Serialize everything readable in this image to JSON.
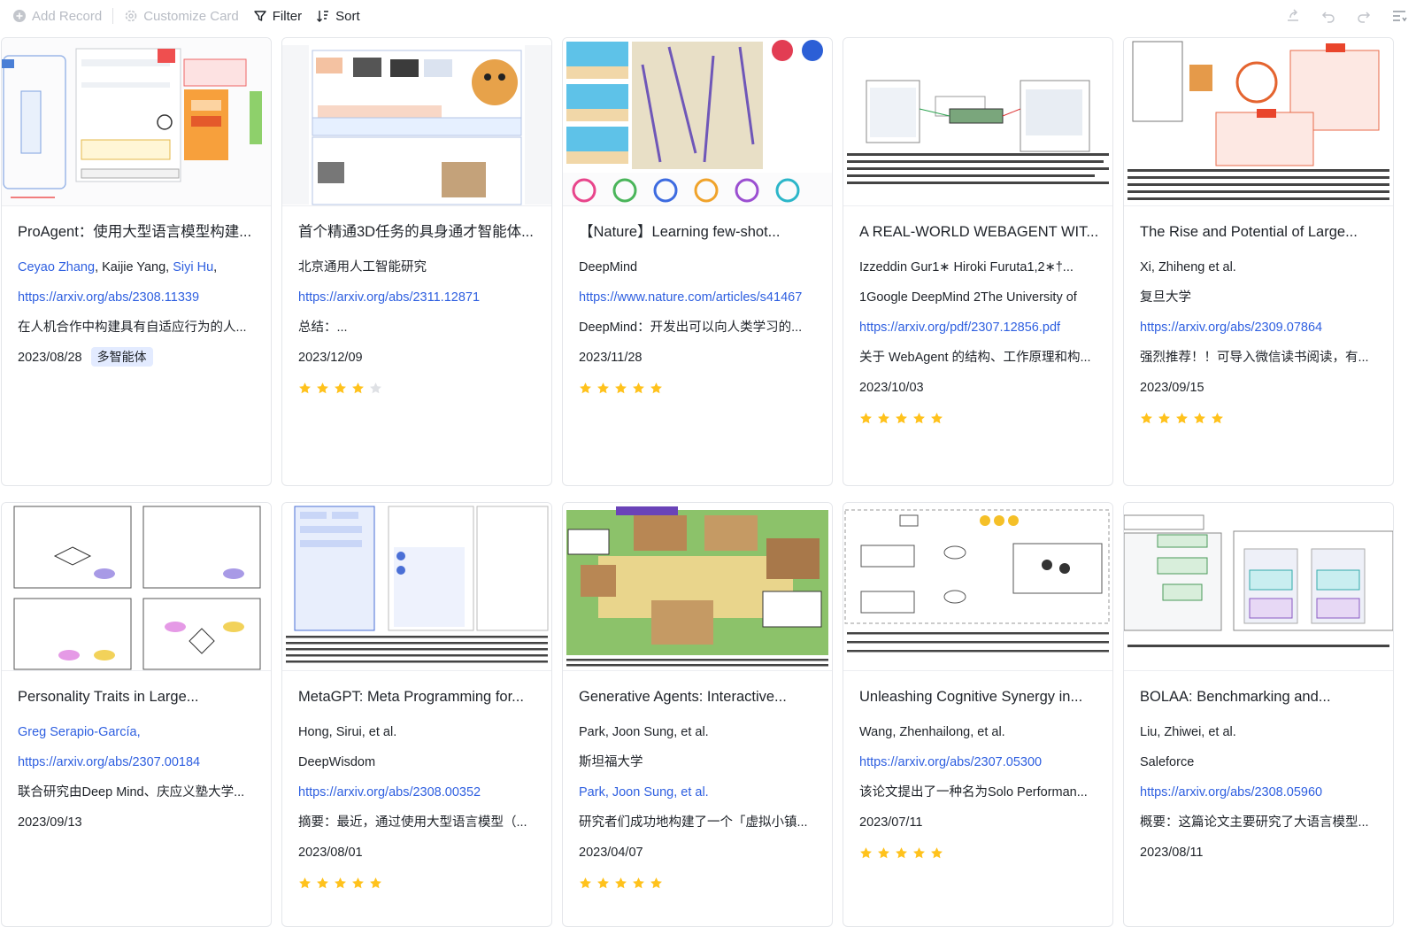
{
  "toolbar": {
    "add_record": "Add Record",
    "customize_card": "Customize Card",
    "filter": "Filter",
    "sort": "Sort"
  },
  "colors": {
    "link": "#2e5fe0",
    "star_on": "#ffc21c",
    "star_off": "#dfe1e5",
    "tag_bg": "#e3ebff"
  },
  "cards": [
    {
      "title": "ProAgent：使用大型语言模型构建...",
      "authors_linked": [
        "Ceyao Zhang",
        ", Kaijie Yang, ",
        "Siyi Hu",
        ","
      ],
      "url": "https://arxiv.org/abs/2308.11339",
      "summary": "在人机合作中构建具有自适应行为的人...",
      "date": "2023/08/28",
      "tag": "多智能体"
    },
    {
      "title": "首个精通3D任务的具身通才智能体...",
      "org": "北京通用人工智能研究",
      "url": "https://arxiv.org/abs/2311.12871",
      "summary": "总结：...",
      "date": "2023/12/09",
      "rating": 4
    },
    {
      "title": "【Nature】Learning few-shot...",
      "org": "DeepMind",
      "url": "https://www.nature.com/articles/s41467",
      "summary": "DeepMind：开发出可以向人类学习的...",
      "date": "2023/11/28",
      "rating": 5
    },
    {
      "title": "A REAL-WORLD WEBAGENT WIT...",
      "authors": "Izzeddin Gur1∗ Hiroki Furuta1,2∗†...",
      "org": "1Google DeepMind 2The University of",
      "url": "https://arxiv.org/pdf/2307.12856.pdf",
      "summary": "关于 WebAgent 的结构、工作原理和构...",
      "date": "2023/10/03",
      "rating": 5
    },
    {
      "title": "The Rise and Potential of Large...",
      "authors": "Xi, Zhiheng et al.",
      "org": "复旦大学",
      "url": "https://arxiv.org/abs/2309.07864",
      "summary": "强烈推荐！！可导入微信读书阅读，有...",
      "date": "2023/09/15",
      "rating": 5
    },
    {
      "title": "Personality Traits in Large...",
      "authors_link": "Greg Serapio-García,",
      "url": "https://arxiv.org/abs/2307.00184",
      "summary": "联合研究由Deep Mind、庆应义塾大学...",
      "date": "2023/09/13"
    },
    {
      "title": "MetaGPT: Meta Programming for...",
      "authors": "Hong, Sirui, et al.",
      "org": "DeepWisdom",
      "url": "https://arxiv.org/abs/2308.00352",
      "summary": "摘要：最近，通过使用大型语言模型（...",
      "date": "2023/08/01",
      "rating": 5
    },
    {
      "title": "Generative Agents: Interactive...",
      "authors": "Park, Joon Sung, et al.",
      "org": "斯坦福大学",
      "url": "Park, Joon Sung, et al.",
      "summary": "研究者们成功地构建了一个「虚拟小镇...",
      "date": "2023/04/07",
      "rating": 5
    },
    {
      "title": "Unleashing Cognitive Synergy in...",
      "authors": "Wang, Zhenhailong, et al.",
      "url": "https://arxiv.org/abs/2307.05300",
      "summary": "该论文提出了一种名为Solo Performan...",
      "date": "2023/07/11",
      "rating": 5
    },
    {
      "title": "BOLAA: Benchmarking and...",
      "authors": "Liu, Zhiwei, et al.",
      "org": "Saleforce",
      "url": "https://arxiv.org/abs/2308.05960",
      "summary": "概要：这篇论文主要研究了大语言模型...",
      "date": "2023/08/11"
    }
  ]
}
